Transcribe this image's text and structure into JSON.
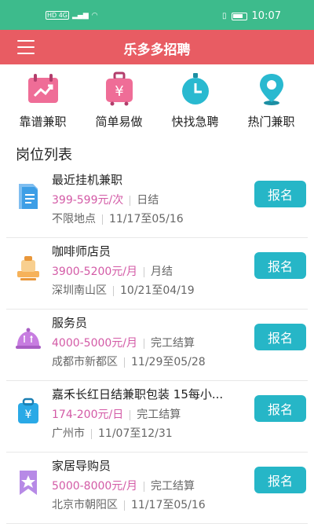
{
  "status_bar": {
    "left": "HD 4G",
    "time": "10:07"
  },
  "app": {
    "title": "乐多多招聘"
  },
  "categories": [
    {
      "label": "靠谱兼职",
      "icon": "calendar-trend-icon",
      "color": "#ec5f8d"
    },
    {
      "label": "简单易做",
      "icon": "suitcase-yen-icon",
      "color": "#ec5f8d"
    },
    {
      "label": "快找急聘",
      "icon": "clock-icon",
      "color": "#26b6c7"
    },
    {
      "label": "热门兼职",
      "icon": "location-pin-icon",
      "color": "#26b6c7"
    }
  ],
  "section_title": "岗位列表",
  "apply_label": "报名",
  "jobs": [
    {
      "title": "最近挂机兼职",
      "salary": "399-599元/次",
      "pay": "日结",
      "location": "不限地点",
      "dates": "11/17至05/16",
      "icon": "document-icon"
    },
    {
      "title": "咖啡师店员",
      "salary": "3900-5200元/月",
      "pay": "月结",
      "location": "深圳南山区",
      "dates": "10/21至04/19",
      "icon": "stamp-icon"
    },
    {
      "title": "服务员",
      "salary": "4000-5000元/月",
      "pay": "完工结算",
      "location": "成都市新都区",
      "dates": "11/29至05/28",
      "icon": "cloche-icon"
    },
    {
      "title": "嘉禾长红日结兼职包装 15每小...",
      "salary": "174-200元/日",
      "pay": "完工结算",
      "location": "广州市",
      "dates": "11/07至12/31",
      "icon": "bag-yen-icon"
    },
    {
      "title": "家居导购员",
      "salary": "5000-8000元/月",
      "pay": "完工结算",
      "location": "北京市朝阳区",
      "dates": "11/17至05/16",
      "icon": "star-bookmark-icon"
    }
  ]
}
